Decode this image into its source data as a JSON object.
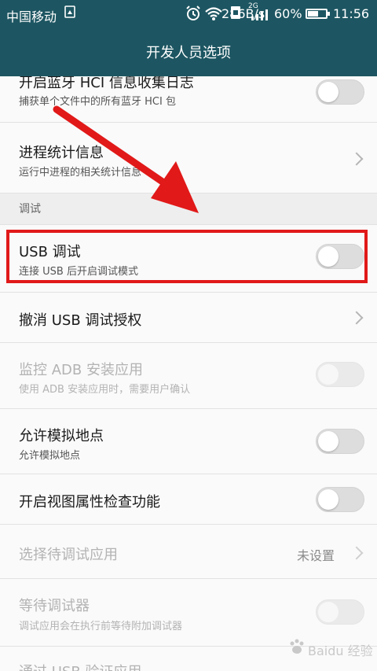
{
  "status_bar": {
    "carrier": "中国移动",
    "net_speed": "286B/s",
    "signal_label": "2G",
    "battery_percent": "60%",
    "battery_level": 0.6,
    "time": "11:56"
  },
  "header": {
    "title": "开发人员选项"
  },
  "rows": {
    "bt_hci": {
      "title": "开启蓝牙 HCI 信息收集日志",
      "subtitle": "捕获单个文件中的所有蓝牙 HCI 包"
    },
    "proc_stats": {
      "title": "进程统计信息",
      "subtitle": "运行中进程的相关统计信息"
    },
    "section_debug": "调试",
    "usb_debug": {
      "title": "USB 调试",
      "subtitle": "连接 USB 后开启调试模式"
    },
    "revoke_usb": {
      "title": "撤消 USB 调试授权"
    },
    "adb_monitor": {
      "title": "监控 ADB 安装应用",
      "subtitle": "使用 ADB 安装应用时，需要用户确认"
    },
    "mock_location": {
      "title": "允许模拟地点",
      "subtitle": "允许模拟地点"
    },
    "view_attr": {
      "title": "开启视图属性检查功能"
    },
    "debug_app": {
      "title": "选择待调试应用",
      "value": "未设置"
    },
    "wait_debugger": {
      "title": "等待调试器",
      "subtitle": "调试应用会在执行前等待附加调试器"
    },
    "verify_usb": {
      "title": "通过 USB 验证应用"
    }
  },
  "watermark": {
    "text": "Baidu 经验"
  },
  "colors": {
    "header": "#1d5662",
    "highlight": "#e11919",
    "arrow": "#e11919"
  }
}
